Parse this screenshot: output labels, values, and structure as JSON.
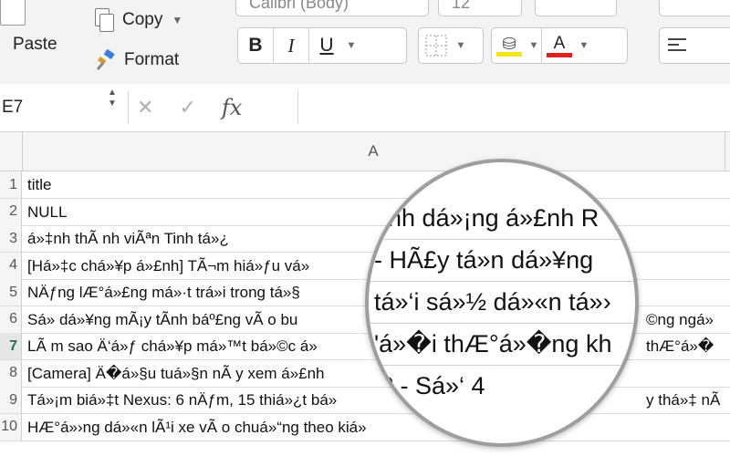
{
  "ribbon": {
    "paste_label": "Paste",
    "copy_label": "Copy",
    "format_label": "Format",
    "font_name": "Calibri (Body)",
    "font_size": "12",
    "bold": "B",
    "italic": "I",
    "underline": "U",
    "font_color_glyph": "A",
    "fill_color": "#f5e61a",
    "font_color": "#e02020"
  },
  "formula_bar": {
    "namebox": "E7",
    "fx": "fx",
    "cancel_glyph": "✕",
    "enter_glyph": "✓"
  },
  "sheet": {
    "column_header": "A",
    "rows": [
      {
        "num": "1",
        "text": "title"
      },
      {
        "num": "2",
        "text": "NULL"
      },
      {
        "num": "3",
        "text": "á»‡nh thÃ nh viÃªn Tinh tá»¿"
      },
      {
        "num": "4",
        "text": "[Há»‡c chá»¥p á»£nh] TÃ¬m hiá»ƒu vá»"
      },
      {
        "num": "5",
        "text": "NÄƒng lÆ°á»£ng má»·t trá»i trong tá»§"
      },
      {
        "num": "6",
        "text": "Sá»­ dá»¥ng mÃ¡y tÃ­nh báº£ng vÃ o bu"
      },
      {
        "num": "7",
        "text": "LÃ m sao Ä‘á»ƒ chá»¥p má»™t bá»©c á»"
      },
      {
        "num": "8",
        "text": "[Camera] Ä�á»§u tuá»§n nÃ y xem á»£nh"
      },
      {
        "num": "9",
        "text": "Tá»¡m biá»‡t Nexus: 6 nÄƒm, 15 thiá»¿t bá»"
      },
      {
        "num": "10",
        "text": "HÆ°á»›ng dá»«n lÃ¹i xe vÃ o chuá»“ng theo kiá»"
      }
    ],
    "active_row": "7",
    "right_fragments": [
      {
        "row": "6",
        "text": "©ng ngá»"
      },
      {
        "row": "7",
        "text": "thÆ°á»�"
      },
      {
        "row": "9",
        "text": "y thá»‡ nÃ"
      }
    ]
  },
  "magnifier": {
    "lines": [
      "ánh dá»¡ng á»£nh R",
      "- HÃ£y tá»­n dá»¥ng",
      "tá»‘i sá»½ dá»«n tá»›",
      "'á»�i thÆ°á»�ng kh",
      "ị? - Sá»‘ 4"
    ]
  }
}
